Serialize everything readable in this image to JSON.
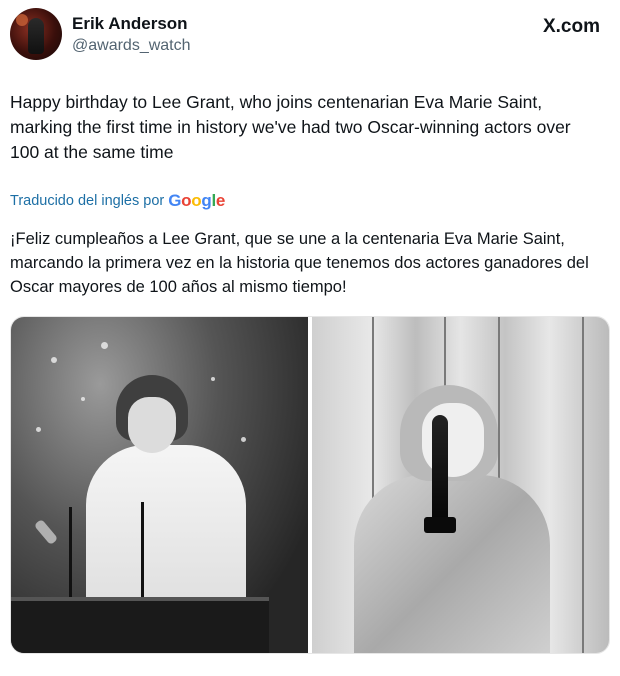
{
  "author": {
    "name": "Erik Anderson",
    "handle": "@awards_watch"
  },
  "brand": "X.com",
  "tweet": {
    "text": "Happy birthday to Lee Grant, who joins centenarian Eva Marie Saint, marking the first time in history we've had two Oscar-winning actors over 100 at the same time"
  },
  "translation": {
    "label": "Traducido del inglés por",
    "provider_letters": [
      "G",
      "o",
      "o",
      "g",
      "l",
      "e"
    ],
    "text": "¡Feliz cumpleaños a Lee Grant, que se une a la centenaria Eva Marie Saint, marcando la primera vez en la historia que tenemos dos actores ganadores del Oscar mayores de 100 años al mismo tiempo!"
  },
  "colors": {
    "link": "#1d6fa5",
    "text": "#0f1419",
    "secondary": "#536471"
  }
}
